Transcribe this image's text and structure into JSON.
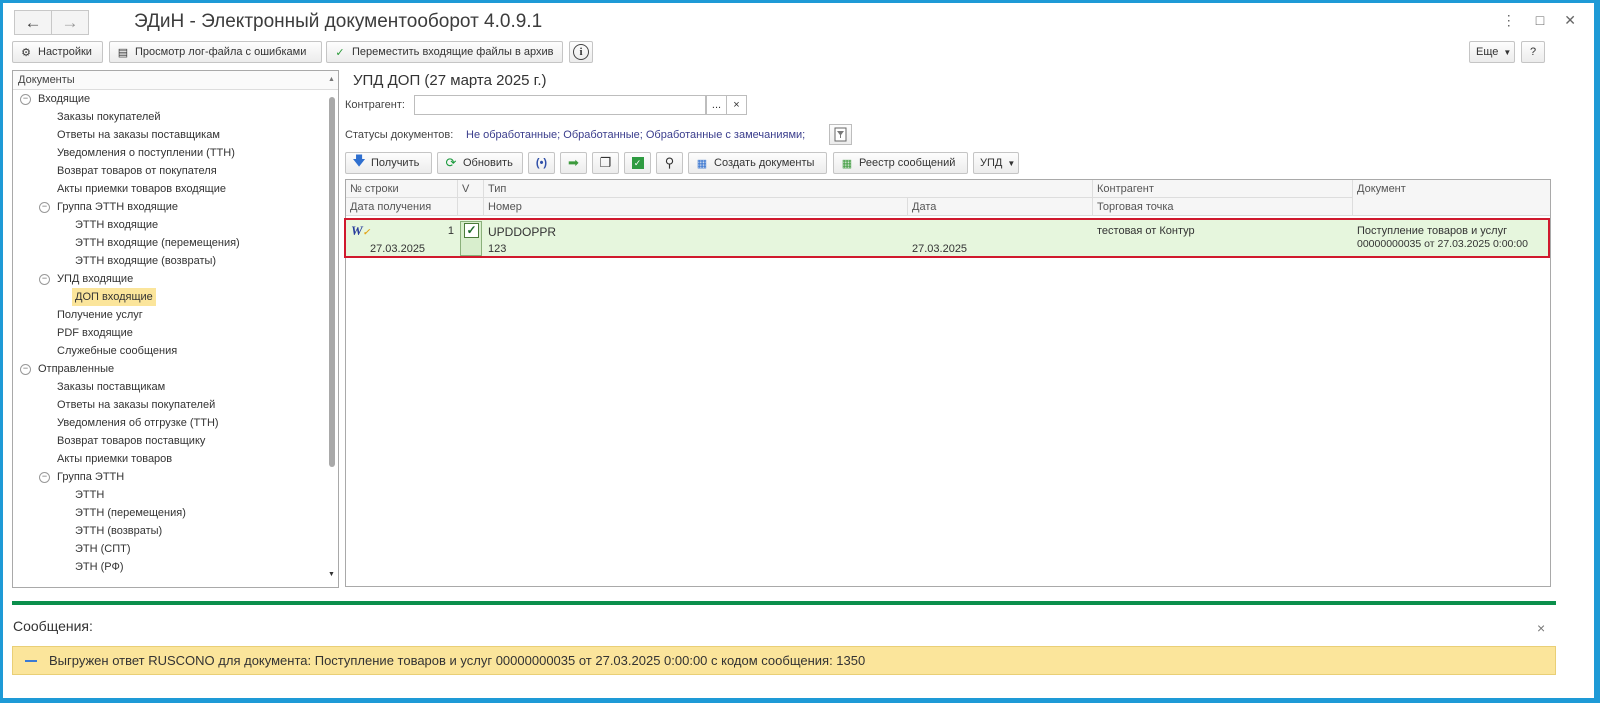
{
  "window": {
    "title": "ЭДиН - Электронный документооборот 4.0.9.1"
  },
  "toolbar": {
    "settings": "Настройки",
    "view_log": "Просмотр лог-файла с ошибками",
    "move_archive": "Переместить входящие файлы в архив",
    "more": "Еще",
    "help": "?"
  },
  "tree": {
    "header": "Документы",
    "nodes": [
      {
        "label": "Входящие"
      },
      {
        "label": "Заказы покупателей"
      },
      {
        "label": "Ответы на заказы поставщикам"
      },
      {
        "label": "Уведомления о поступлении (ТТН)"
      },
      {
        "label": "Возврат товаров от покупателя"
      },
      {
        "label": "Акты приемки товаров входящие"
      },
      {
        "label": "Группа ЭТТН входящие"
      },
      {
        "label": "ЭТТН входящие"
      },
      {
        "label": "ЭТТН входящие (перемещения)"
      },
      {
        "label": "ЭТТН входящие (возвраты)"
      },
      {
        "label": "УПД входящие"
      },
      {
        "label": "ДОП входящие"
      },
      {
        "label": "Получение услуг"
      },
      {
        "label": "PDF входящие"
      },
      {
        "label": "Служебные сообщения"
      },
      {
        "label": "Отправленные"
      },
      {
        "label": "Заказы поставщикам"
      },
      {
        "label": "Ответы на заказы покупателей"
      },
      {
        "label": "Уведомления об отгрузке (ТТН)"
      },
      {
        "label": "Возврат товаров поставщику"
      },
      {
        "label": "Акты приемки товаров"
      },
      {
        "label": "Группа ЭТТН"
      },
      {
        "label": "ЭТТН"
      },
      {
        "label": "ЭТТН (перемещения)"
      },
      {
        "label": "ЭТТН (возвраты)"
      },
      {
        "label": "ЭТН (СПТ)"
      },
      {
        "label": "ЭТН (РФ)"
      }
    ]
  },
  "main": {
    "title": "УПД ДОП (27 марта 2025 г.)",
    "kontragent_label": "Контрагент:",
    "kontragent_value": "",
    "select_btn": "...",
    "clear_btn": "×",
    "statuses_label": "Статусы документов:",
    "statuses_value": "Не обработанные; Обработанные; Обработанные с замечаниями;",
    "buttons": {
      "receive": "Получить",
      "refresh": "Обновить",
      "create_docs": "Создать документы",
      "registry": "Реестр сообщений",
      "upd": "УПД"
    }
  },
  "table": {
    "headers": {
      "row_no": "№ строки",
      "v": "V",
      "type": "Тип",
      "kontragent": "Контрагент",
      "document": "Документ",
      "date_received": "Дата получения",
      "number": "Номер",
      "date": "Дата",
      "trade_point": "Торговая точка"
    },
    "rows": [
      {
        "row_no": "1",
        "date_received": "27.03.2025",
        "checked": true,
        "type": "UPDDOPPR",
        "number": "123",
        "date": "27.03.2025",
        "kontragent": "тестовая от Контур",
        "document_line1": "Поступление товаров и услуг",
        "document_line2": "00000000035 от 27.03.2025 0:00:00"
      }
    ]
  },
  "messages": {
    "title": "Сообщения:",
    "close": "×",
    "items": [
      "Выгружен ответ RUSCONO для документа: Поступление товаров и услуг 00000000035 от 27.03.2025 0:00:00 с кодом сообщения: 1350"
    ]
  },
  "colors": {
    "accent_frame": "#1e9ad6",
    "highlight": "#fbe59b",
    "row_green": "#e6f6dd",
    "outline_red": "#d0192d",
    "separator_green": "#0b8f4c"
  }
}
